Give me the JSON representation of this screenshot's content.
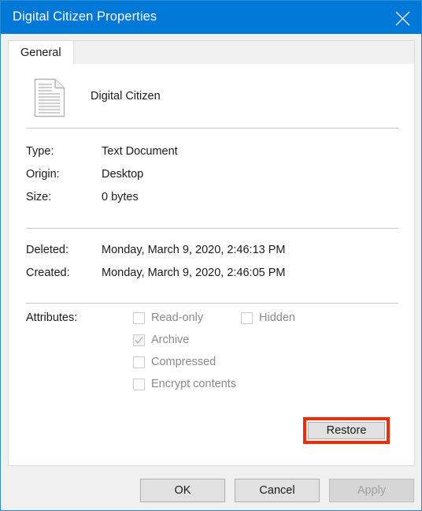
{
  "window": {
    "title": "Digital Citizen Properties",
    "close_icon": "close-icon",
    "accent_color": "#0078d7",
    "annotation_color": "#f42a00"
  },
  "tabs": [
    {
      "label": "General",
      "active": true
    }
  ],
  "file": {
    "icon": "text-document-icon",
    "name": "Digital Citizen"
  },
  "details": [
    {
      "label": "Type:",
      "value": "Text Document"
    },
    {
      "label": "Origin:",
      "value": "Desktop"
    },
    {
      "label": "Size:",
      "value": "0 bytes"
    }
  ],
  "dates": [
    {
      "label": "Deleted:",
      "value": "Monday, March 9, 2020, 2:46:13 PM"
    },
    {
      "label": "Created:",
      "value": "Monday, March 9, 2020, 2:46:05 PM"
    }
  ],
  "attributes": {
    "label": "Attributes:",
    "items": [
      {
        "label": "Read-only",
        "checked": false,
        "enabled": false
      },
      {
        "label": "Hidden",
        "checked": false,
        "enabled": false
      },
      {
        "label": "Archive",
        "checked": true,
        "enabled": false
      },
      {
        "label": "Compressed",
        "checked": false,
        "enabled": false
      },
      {
        "label": "Encrypt contents",
        "checked": false,
        "enabled": false
      }
    ]
  },
  "actions": {
    "restore_label": "Restore"
  },
  "footer": {
    "ok_label": "OK",
    "cancel_label": "Cancel",
    "apply_label": "Apply",
    "apply_enabled": false
  }
}
